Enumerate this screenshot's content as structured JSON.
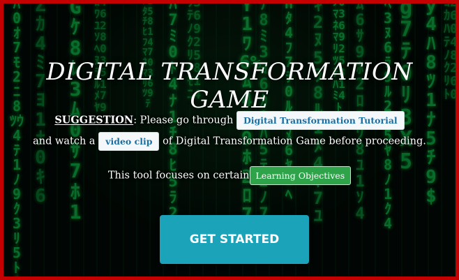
{
  "page": {
    "title": "DIGITAL TRANSFORMATION GAME",
    "suggestion_label": "SUGGESTION",
    "suggestion_text": ": Please go through",
    "tutorial_button": "Digital Transformation Tutorial",
    "watch_text": "and watch a",
    "video_button": "video clip",
    "after_video_text": "of Digital Transformation Game before proceeding.",
    "focus_text": "This tool focuses on certain",
    "objectives_button": "Learning Objectives",
    "get_started_button": "GET STARTED"
  },
  "colors": {
    "border": "#c40000",
    "matrix_green": "#13e85a",
    "start_button": "#1ba3b9",
    "objectives_button": "#2ea34a",
    "link_text": "#1a6fa3"
  }
}
